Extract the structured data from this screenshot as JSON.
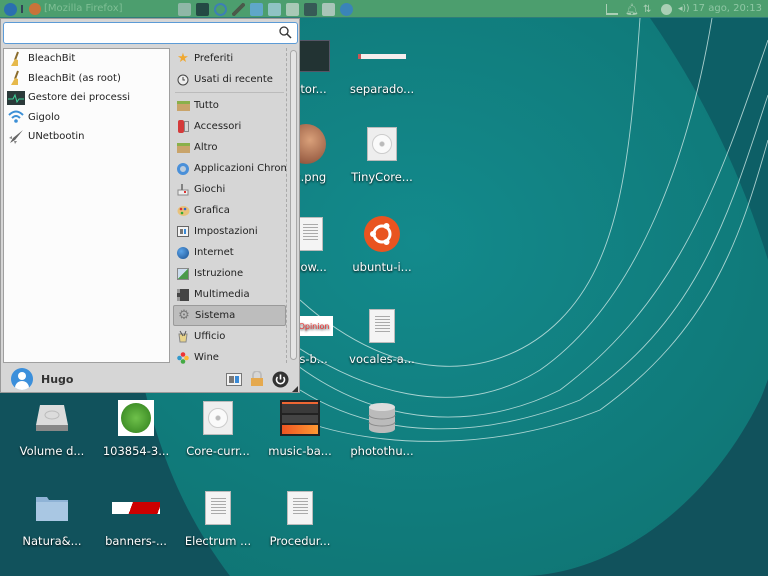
{
  "panel": {
    "active_window": "[Mozilla Firefox]",
    "launchers": [
      "text-editor",
      "terminal",
      "app-switch",
      "paint",
      "window-a",
      "window-b",
      "notes",
      "calculator",
      "search-files",
      "thunderbird"
    ],
    "tray": [
      "notes-icon",
      "notification-bell",
      "network-arrows",
      "power",
      "volume"
    ],
    "clock": "17 ago, 20:13"
  },
  "menu": {
    "search": {
      "value": "",
      "placeholder": ""
    },
    "apps": [
      {
        "label": "BleachBit",
        "icon": "broom-icon"
      },
      {
        "label": "BleachBit (as root)",
        "icon": "broom-icon"
      },
      {
        "label": "Gestore dei processi",
        "icon": "process-monitor-icon"
      },
      {
        "label": "Gigolo",
        "icon": "wifi-icon"
      },
      {
        "label": "UNetbootin",
        "icon": "shuttle-icon"
      }
    ],
    "categories_top": [
      {
        "label": "Preferiti",
        "icon": "star-icon"
      },
      {
        "label": "Usati di recente",
        "icon": "clock-icon"
      }
    ],
    "categories": [
      {
        "label": "Tutto",
        "icon": "box-icon"
      },
      {
        "label": "Accessori",
        "icon": "tools-icon"
      },
      {
        "label": "Altro",
        "icon": "box-icon"
      },
      {
        "label": "Applicazioni Chromium",
        "icon": "chromium-icon"
      },
      {
        "label": "Giochi",
        "icon": "joystick-icon"
      },
      {
        "label": "Grafica",
        "icon": "palette-icon"
      },
      {
        "label": "Impostazioni",
        "icon": "settings-icon"
      },
      {
        "label": "Internet",
        "icon": "globe-icon"
      },
      {
        "label": "Istruzione",
        "icon": "education-icon"
      },
      {
        "label": "Multimedia",
        "icon": "film-icon"
      },
      {
        "label": "Sistema",
        "icon": "gear-icon",
        "selected": true
      },
      {
        "label": "Ufficio",
        "icon": "office-icon"
      },
      {
        "label": "Wine",
        "icon": "wine-icon"
      }
    ],
    "user": "Hugo"
  },
  "desktop": {
    "icons": [
      {
        "label": "ator...",
        "kind": "terminal"
      },
      {
        "label": "separado...",
        "kind": "banner-thin"
      },
      {
        "label": "x.png",
        "kind": "photo"
      },
      {
        "label": "TinyCore...",
        "kind": "cd"
      },
      {
        "label": "dow...",
        "kind": "doc"
      },
      {
        "label": "ubuntu-i...",
        "kind": "ubuntu"
      },
      {
        "label": "es-b...",
        "kind": "opinion"
      },
      {
        "label": "vocales-a...",
        "kind": "doc"
      },
      {
        "label": "Volume d...",
        "kind": "drive"
      },
      {
        "label": "103854-3...",
        "kind": "green-chef"
      },
      {
        "label": "Core-curr...",
        "kind": "cd"
      },
      {
        "label": "music-ba...",
        "kind": "music"
      },
      {
        "label": "photothu...",
        "kind": "database"
      },
      {
        "label": "Natura&...",
        "kind": "folder"
      },
      {
        "label": "banners-...",
        "kind": "red-banner"
      },
      {
        "label": "Electrum ...",
        "kind": "doc"
      },
      {
        "label": "Procedur...",
        "kind": "doc"
      }
    ],
    "opinion_text": "Opinion"
  }
}
